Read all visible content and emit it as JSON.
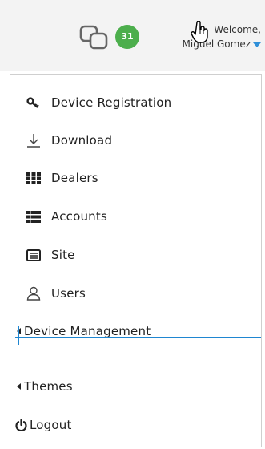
{
  "header": {
    "badge_count": "31",
    "welcome_label": "Welcome,",
    "user_name": "Miguel Gomez",
    "icons": {
      "chat": "chat-bubbles-icon",
      "caret": "caret-down-icon",
      "cursor": "hand-pointer-icon"
    },
    "colors": {
      "badge": "#4cae4c",
      "caret": "#2f8fd8"
    }
  },
  "menu": {
    "items": [
      {
        "label": "Device Registration",
        "icon": "key-icon"
      },
      {
        "label": "Download",
        "icon": "download-icon"
      },
      {
        "label": "Dealers",
        "icon": "grid-icon"
      },
      {
        "label": "Accounts",
        "icon": "list-icon"
      },
      {
        "label": "Site",
        "icon": "card-icon"
      },
      {
        "label": "Users",
        "icon": "user-icon"
      },
      {
        "label": "Device Management",
        "icon": "caret-left-icon"
      },
      {
        "label": "Themes",
        "icon": "caret-left-icon"
      },
      {
        "label": "Logout",
        "icon": "power-icon"
      }
    ],
    "divider_color": "#1f86d1"
  }
}
